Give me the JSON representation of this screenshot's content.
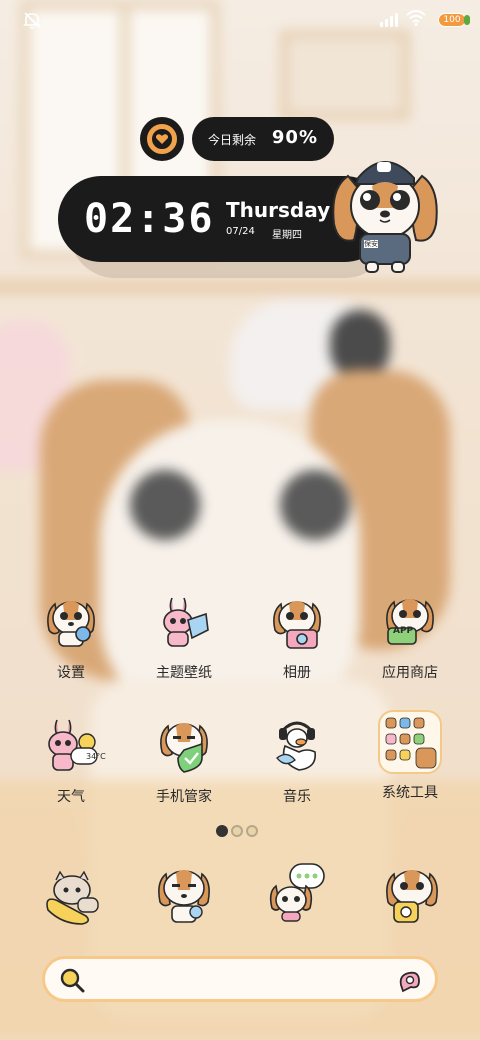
{
  "status_bar": {
    "battery_level": "100",
    "icons": [
      "mute-icon",
      "signal-icon",
      "wifi-icon",
      "battery-icon"
    ]
  },
  "widgets": {
    "remaining": {
      "label": "今日剩余",
      "value": "90%"
    },
    "clock": {
      "time": "02:36",
      "day": "Thursday",
      "date": "07/24",
      "weekday": "星期四"
    },
    "guard_badge": "保安"
  },
  "apps": [
    {
      "label": "设置",
      "icon": "settings-dog-icon"
    },
    {
      "label": "主题壁纸",
      "icon": "themes-bunny-icon"
    },
    {
      "label": "相册",
      "icon": "gallery-dog-icon"
    },
    {
      "label": "应用商店",
      "icon": "appstore-dog-icon"
    },
    {
      "label": "天气",
      "icon": "weather-bunny-icon",
      "badge": "34°C"
    },
    {
      "label": "手机管家",
      "icon": "phone-manager-dog-icon"
    },
    {
      "label": "音乐",
      "icon": "music-duck-icon"
    },
    {
      "label": "系统工具",
      "icon": "system-tools-folder-icon"
    }
  ],
  "app_store_badge": "APP",
  "page_indicator": {
    "pages": 3,
    "current": 1
  },
  "dock": [
    {
      "icon": "dock-cat-phone-icon"
    },
    {
      "icon": "dock-dog-icon"
    },
    {
      "icon": "dock-dog-message-icon"
    },
    {
      "icon": "dock-dog-camera-icon"
    }
  ],
  "search": {
    "placeholder": ""
  },
  "colors": {
    "accent": "#f2a24a",
    "widget_bg": "#1b1b1b",
    "search_border": "#f6c98a",
    "dog_brown": "#d9985a"
  }
}
